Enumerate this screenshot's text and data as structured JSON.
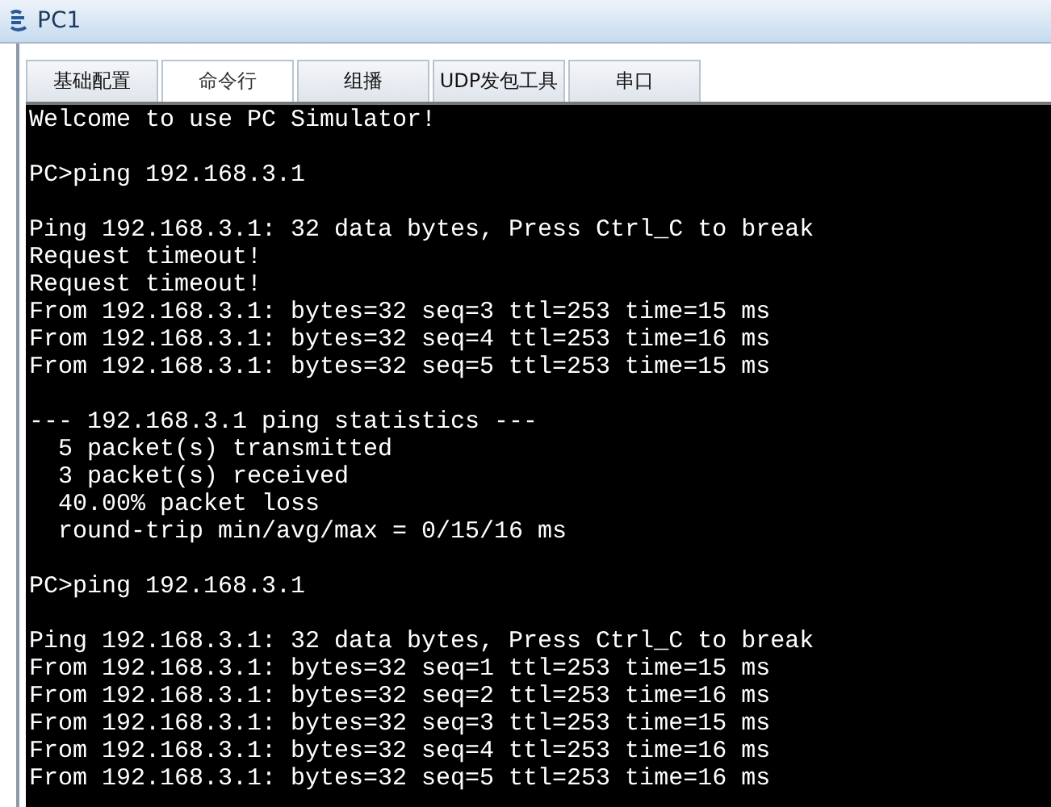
{
  "window": {
    "title": "PC1"
  },
  "tabs": [
    {
      "label": "基础配置",
      "selected": false
    },
    {
      "label": "命令行",
      "selected": true
    },
    {
      "label": "组播",
      "selected": false
    },
    {
      "label": "UDP发包工具",
      "selected": false
    },
    {
      "label": "串口",
      "selected": false
    }
  ],
  "console": {
    "blocks": [
      [
        "Welcome to use PC Simulator!"
      ],
      [
        "PC>ping 192.168.3.1"
      ],
      [
        "Ping 192.168.3.1: 32 data bytes, Press Ctrl_C to break",
        "Request timeout!",
        "Request timeout!",
        "From 192.168.3.1: bytes=32 seq=3 ttl=253 time=15 ms",
        "From 192.168.3.1: bytes=32 seq=4 ttl=253 time=16 ms",
        "From 192.168.3.1: bytes=32 seq=5 ttl=253 time=15 ms"
      ],
      [
        "--- 192.168.3.1 ping statistics ---",
        "  5 packet(s) transmitted",
        "  3 packet(s) received",
        "  40.00% packet loss",
        "  round-trip min/avg/max = 0/15/16 ms"
      ],
      [
        "PC>ping 192.168.3.1"
      ],
      [
        "Ping 192.168.3.1: 32 data bytes, Press Ctrl_C to break",
        "From 192.168.3.1: bytes=32 seq=1 ttl=253 time=15 ms",
        "From 192.168.3.1: bytes=32 seq=2 ttl=253 time=16 ms",
        "From 192.168.3.1: bytes=32 seq=3 ttl=253 time=15 ms",
        "From 192.168.3.1: bytes=32 seq=4 ttl=253 time=16 ms",
        "From 192.168.3.1: bytes=32 seq=5 ttl=253 time=16 ms"
      ]
    ]
  }
}
